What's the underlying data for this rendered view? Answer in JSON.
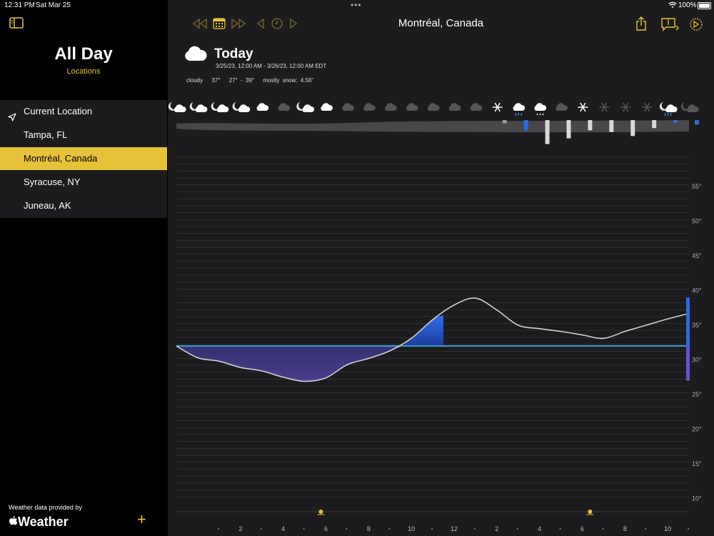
{
  "status_bar": {
    "time": "12:31 PM",
    "date": "Sat Mar 25",
    "battery": "100%"
  },
  "sidebar": {
    "title": "All Day",
    "subtitle": "Locations",
    "locations": [
      {
        "label": "Current Location"
      },
      {
        "label": "Tampa, FL"
      },
      {
        "label": "Montréal, Canada"
      },
      {
        "label": "Syracuse, NY"
      },
      {
        "label": "Juneau, AK"
      }
    ],
    "selected_index": 2,
    "credit": "Weather data provided by",
    "brand": "Weather"
  },
  "header": {
    "location_title": "Montréal, Canada",
    "day_label": "Today",
    "date_range": "3/25/23, 12:00 AM - 3/26/23, 12:00 AM EDT",
    "condition": "cloudy",
    "current_temp": "37°",
    "temp_range": "27° - 39°",
    "precip": "mostly snow: 4.56\""
  },
  "colors": {
    "accent": "#e6c23a",
    "freeze_line": "#3aa0d8",
    "warm_fill": "#2a5bd8",
    "cold_fill": "#5a4ab0"
  },
  "hourly_icons": [
    "moon-cloud-icon",
    "moon-cloud-icon",
    "moon-cloud-icon",
    "moon-cloud-icon",
    "cloud-icon",
    "cloud-dim-icon",
    "moon-cloud-icon",
    "cloud-icon",
    "cloud-dim-icon",
    "cloud-dim-icon",
    "cloud-dim-icon",
    "cloud-dim-icon",
    "cloud-dim-icon",
    "cloud-dim-icon",
    "cloud-dim-icon",
    "snowflake-icon",
    "rain-cloud-icon",
    "snow-cloud-icon",
    "cloud-dim-icon",
    "snowflake-icon",
    "snowflake-dim-icon",
    "snowflake-dim-icon",
    "snowflake-dim-icon",
    "moon-rain-icon",
    "moon-cloud-dim-icon"
  ],
  "chart_data": {
    "type": "line",
    "x_hours": [
      0,
      1,
      2,
      3,
      4,
      5,
      6,
      7,
      8,
      9,
      10,
      11,
      12,
      13,
      14,
      15,
      16,
      17,
      18,
      19,
      20,
      21,
      22,
      23,
      24
    ],
    "temperature": [
      32,
      30.3,
      29.8,
      28.9,
      28.4,
      27.5,
      26.9,
      27.4,
      29.3,
      30.2,
      31.3,
      33.1,
      35.8,
      37.9,
      38.9,
      37.2,
      35,
      34.5,
      34.1,
      33.6,
      33.1,
      34.1,
      35,
      35.9,
      36.7
    ],
    "freezing_line": 32,
    "y_ticks": [
      "55°",
      "50°",
      "45°",
      "40°",
      "35°",
      "30°",
      "25°",
      "20°",
      "15°",
      "10°"
    ],
    "y_tick_values": [
      55,
      50,
      45,
      40,
      35,
      30,
      25,
      20,
      15,
      10
    ],
    "x_tick_labels": [
      "2",
      "4",
      "6",
      "8",
      "10",
      "12",
      "2",
      "4",
      "6",
      "8",
      "10"
    ],
    "x_tick_hours": [
      2,
      4,
      6,
      8,
      10,
      12,
      14,
      16,
      18,
      20,
      22
    ],
    "ylim": [
      8,
      58
    ],
    "precip_bars": [
      0,
      0,
      0,
      0,
      0,
      0,
      0,
      0,
      0,
      0,
      0,
      0,
      0,
      0,
      0,
      0.06,
      0.18,
      0.42,
      0.32,
      0.18,
      0.21,
      0.28,
      0.14,
      0.05,
      0.08
    ],
    "precip_colors": [
      "#000",
      "#000",
      "#000",
      "#000",
      "#000",
      "#000",
      "#000",
      "#000",
      "#000",
      "#000",
      "#000",
      "#000",
      "#000",
      "#000",
      "#000",
      "#9a9a9a",
      "#2a6be0",
      "#d8d8d8",
      "#d8d8d8",
      "#d8d8d8",
      "#d8d8d8",
      "#d8d8d8",
      "#d8d8d8",
      "#2a6be0",
      "#2a6be0"
    ],
    "grid": true
  }
}
